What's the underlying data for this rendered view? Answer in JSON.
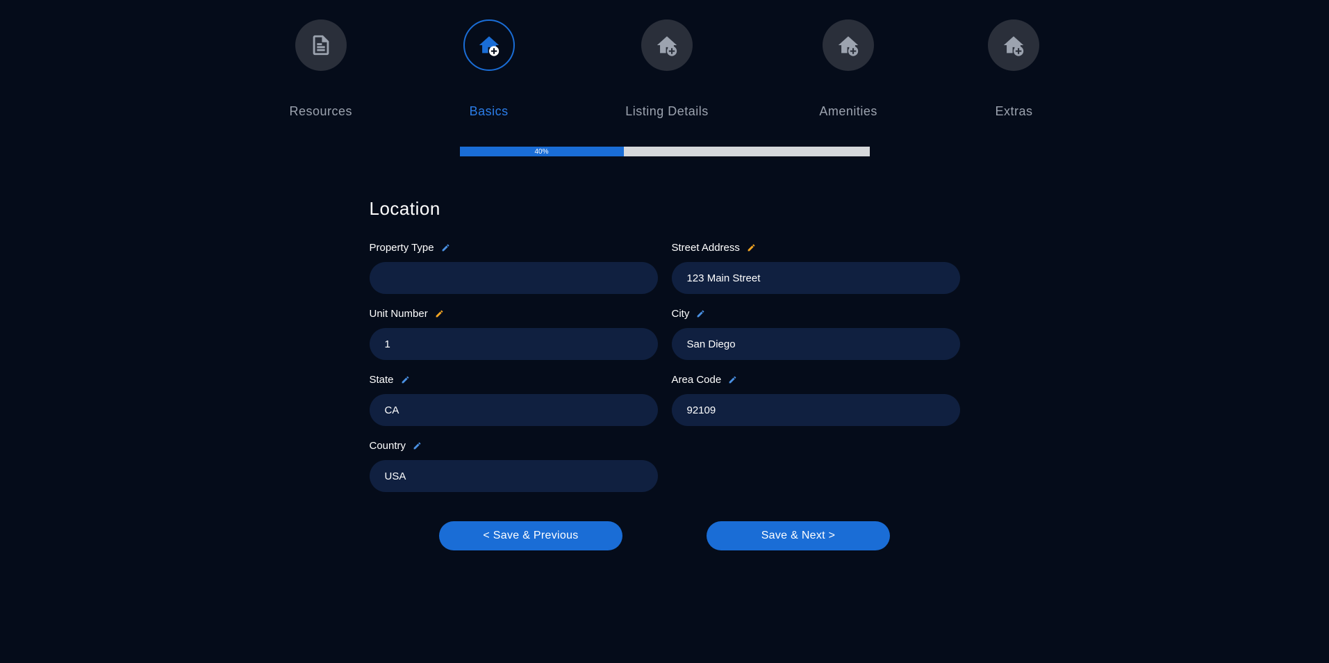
{
  "steps": {
    "resources": {
      "label": "Resources"
    },
    "basics": {
      "label": "Basics"
    },
    "listing_details": {
      "label": "Listing Details"
    },
    "amenities": {
      "label": "Amenities"
    },
    "extras": {
      "label": "Extras"
    }
  },
  "progress": {
    "percent_text": "40%"
  },
  "section": {
    "title": "Location"
  },
  "fields": {
    "property_type": {
      "label": "Property Type",
      "value": ""
    },
    "street_address": {
      "label": "Street Address",
      "value": "123 Main Street"
    },
    "unit_number": {
      "label": "Unit Number",
      "value": "1"
    },
    "city": {
      "label": "City",
      "value": "San Diego"
    },
    "state": {
      "label": "State",
      "value": "CA"
    },
    "area_code": {
      "label": "Area Code",
      "value": "92109"
    },
    "country": {
      "label": "Country",
      "value": "USA"
    }
  },
  "buttons": {
    "previous": "< Save & Previous",
    "next": "Save & Next >"
  }
}
